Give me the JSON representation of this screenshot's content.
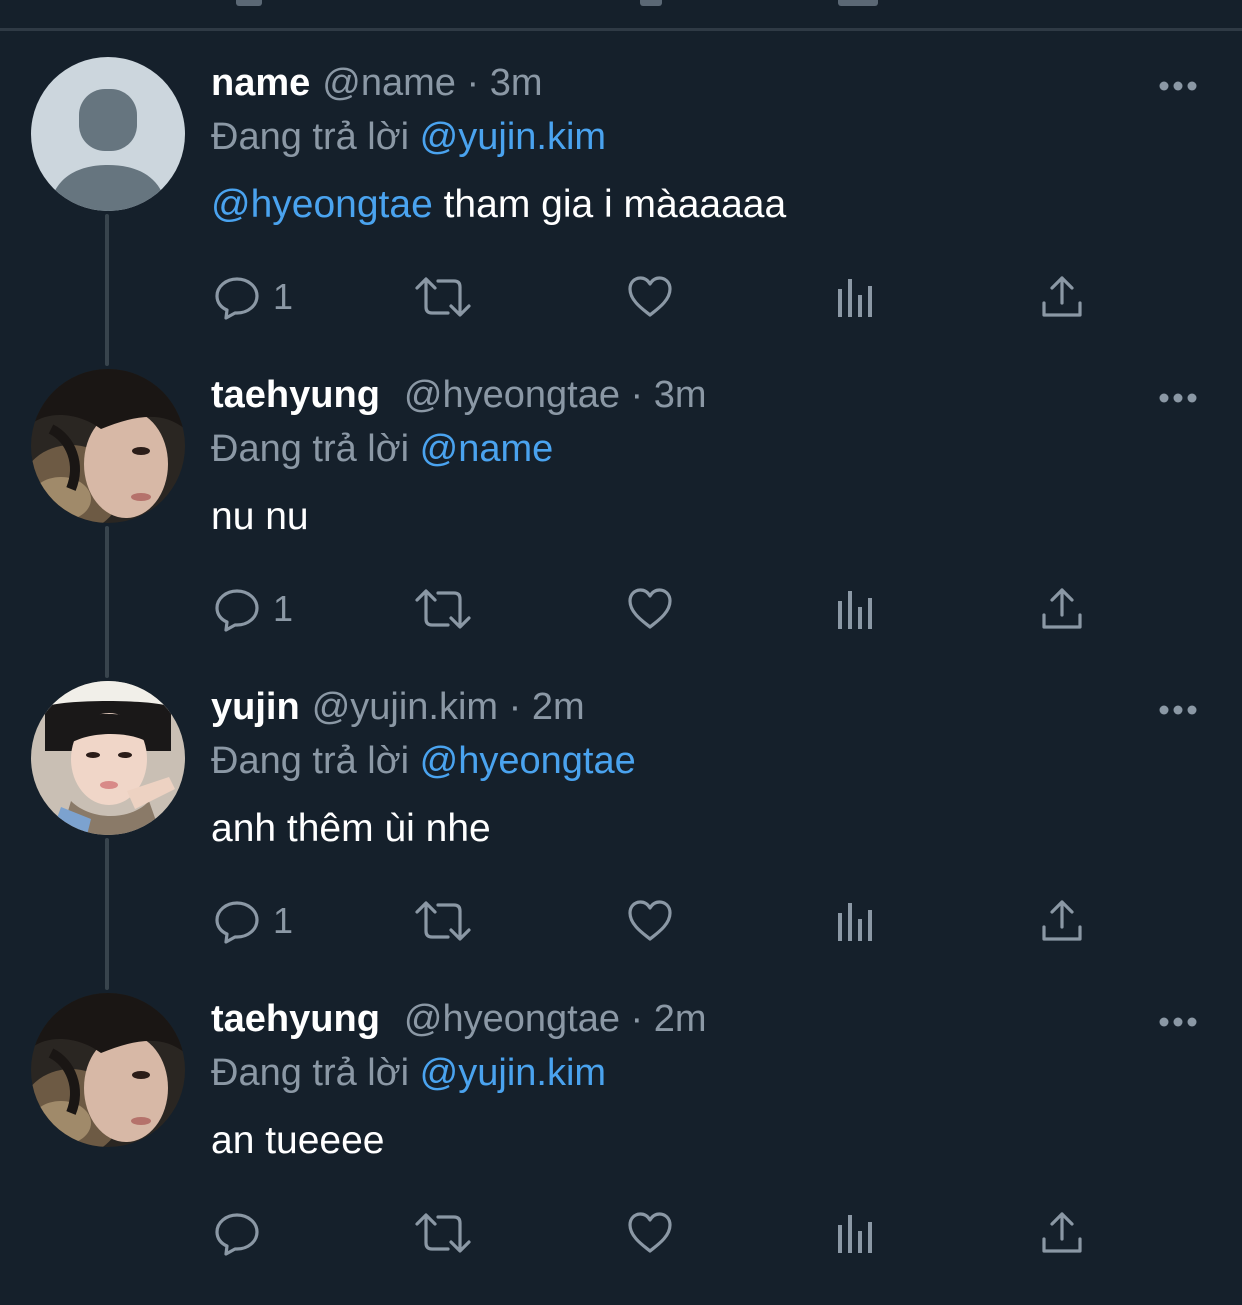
{
  "colors": {
    "background": "#15202b",
    "divider": "#2f3a45",
    "secondary_text": "#8b98a5",
    "mention": "#4aa3ef",
    "icon": "#8b98a5"
  },
  "thread": [
    {
      "display_name": "name",
      "handle": "@name",
      "separator": "·",
      "time": "3m",
      "replying_prefix": "Đang trả lời",
      "replying_to": "@yujin.kim",
      "body_mention": "@hyeongtae",
      "body_text": " tham gia i màaaaaa",
      "avatar": "default-avatar",
      "reply_count": "1"
    },
    {
      "display_name": "taehyung",
      "handle": "@hyeongtae",
      "separator": "·",
      "time": "3m",
      "replying_prefix": "Đang trả lời",
      "replying_to": "@name",
      "body_mention": "",
      "body_text": "nu nu",
      "avatar": "photo-avatar",
      "reply_count": "1"
    },
    {
      "display_name": "yujin",
      "handle": "@yujin.kim",
      "separator": "·",
      "time": "2m",
      "replying_prefix": "Đang trả lời",
      "replying_to": "@hyeongtae",
      "body_mention": "",
      "body_text": "anh thêm ùi nhe",
      "avatar": "photo-avatar",
      "reply_count": "1"
    },
    {
      "display_name": "taehyung",
      "handle": "@hyeongtae",
      "separator": "·",
      "time": "2m",
      "replying_prefix": "Đang trả lời",
      "replying_to": "@yujin.kim",
      "body_mention": "",
      "body_text": "an tueeee",
      "avatar": "photo-avatar",
      "reply_count": ""
    }
  ],
  "action_icons": [
    "reply-icon",
    "retweet-icon",
    "like-icon",
    "analytics-icon",
    "share-icon"
  ],
  "more_icon": "more-options-icon"
}
